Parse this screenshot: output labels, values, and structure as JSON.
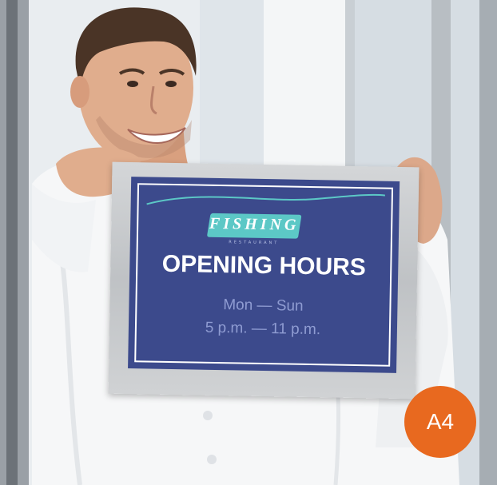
{
  "sign": {
    "logo_text": "FISHING",
    "logo_sub": "RESTAURANT",
    "title": "OPENING HOURS",
    "days": "Mon — Sun",
    "time": "5 p.m. — 11 p.m."
  },
  "badge": {
    "label": "A4"
  },
  "colors": {
    "sign_panel": "#3c4a8c",
    "logo_banner": "#5cc8c6",
    "badge": "#e8691f",
    "text_secondary": "#8f9cd2"
  }
}
